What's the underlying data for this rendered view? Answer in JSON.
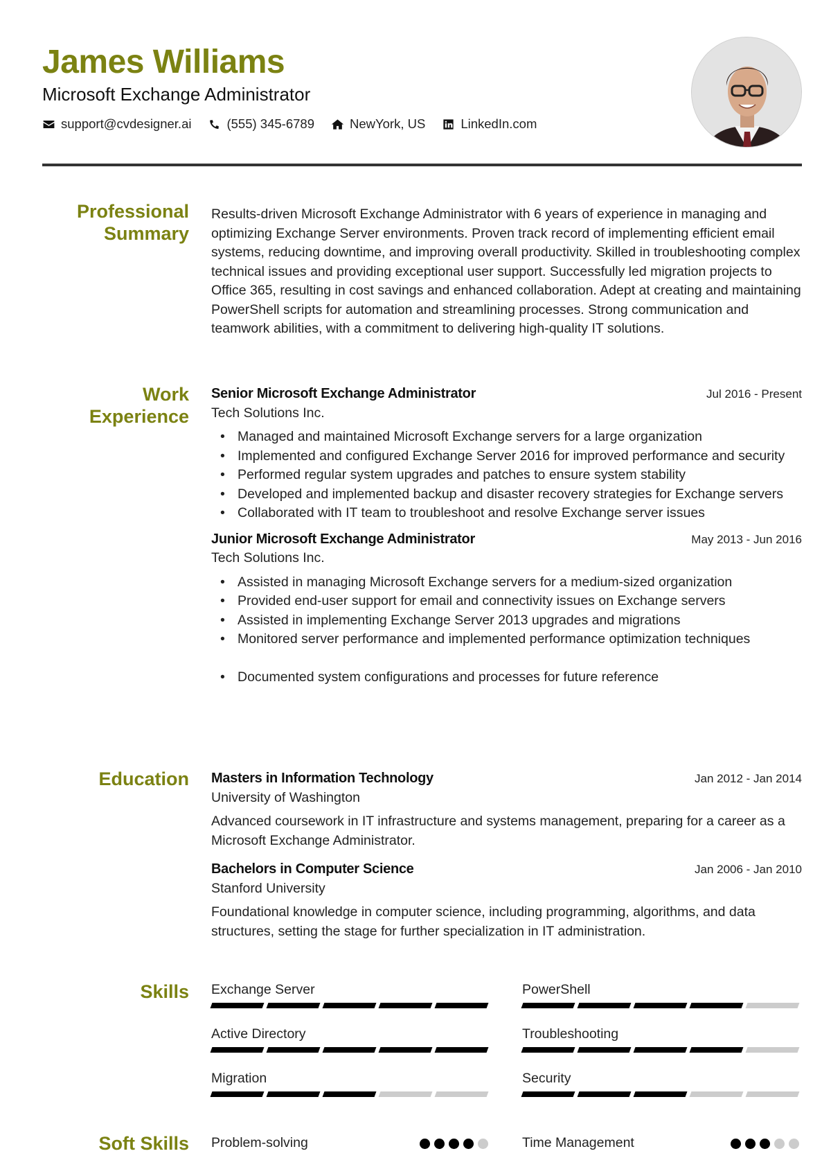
{
  "header": {
    "name": "James Williams",
    "title": "Microsoft Exchange Administrator",
    "contacts": [
      {
        "icon": "envelope-icon",
        "text": "support@cvdesigner.ai"
      },
      {
        "icon": "phone-icon",
        "text": "(555) 345-6789"
      },
      {
        "icon": "home-icon",
        "text": "NewYork, US"
      },
      {
        "icon": "linkedin-icon",
        "text": "LinkedIn.com"
      }
    ],
    "photo_alt": "Profile photo of James Williams"
  },
  "colors": {
    "accent": "#7b8212",
    "text": "#222222",
    "divider": "#333333",
    "bar_on": "#000000",
    "bar_off": "#cccccc"
  },
  "summary": {
    "label": "Professional Summary",
    "text": "Results-driven Microsoft Exchange Administrator with 6 years of experience in managing and optimizing Exchange Server environments. Proven track record of implementing efficient email systems, reducing downtime, and improving overall productivity. Skilled in troubleshooting complex technical issues and providing exceptional user support. Successfully led migration projects to Office 365, resulting in cost savings and enhanced collaboration. Adept at creating and maintaining PowerShell scripts for automation and streamlining processes. Strong communication and teamwork abilities, with a commitment to delivering high-quality IT solutions."
  },
  "experience": {
    "label": "Work Experience",
    "jobs": [
      {
        "title": "Senior Microsoft Exchange Administrator",
        "company": "Tech Solutions Inc.",
        "dates": "Jul 2016 - Present",
        "bullets": [
          "Managed and maintained Microsoft Exchange servers for a large organization",
          "Implemented and configured Exchange Server 2016 for improved performance and security",
          "Performed regular system upgrades and patches to ensure system stability",
          "Developed and implemented backup and disaster recovery strategies for Exchange servers",
          "Collaborated with IT team to troubleshoot and resolve Exchange server issues"
        ]
      },
      {
        "title": "Junior Microsoft Exchange Administrator",
        "company": "Tech Solutions Inc.",
        "dates": "May 2013 - Jun 2016",
        "bullets": [
          "Assisted in managing Microsoft Exchange servers for a medium-sized organization",
          "Provided end-user support for email and connectivity issues on Exchange servers",
          "Assisted in implementing Exchange Server 2013 upgrades and migrations",
          "Monitored server performance and implemented performance optimization techniques",
          "Documented system configurations and processes for future reference"
        ]
      }
    ]
  },
  "education": {
    "label": "Education",
    "items": [
      {
        "degree": "Masters in Information Technology",
        "school": "University of Washington",
        "dates": "Jan 2012 - Jan 2014",
        "description": "Advanced coursework in IT infrastructure and systems management, preparing for a career as a Microsoft Exchange Administrator."
      },
      {
        "degree": "Bachelors in Computer Science",
        "school": "Stanford University",
        "dates": "Jan 2006 - Jan 2010",
        "description": "Foundational knowledge in computer science, including programming, algorithms, and data structures, setting the stage for further specialization in IT administration."
      }
    ]
  },
  "skills": {
    "label": "Skills",
    "max_level": 5,
    "items": [
      {
        "name": "Exchange Server",
        "level": 5
      },
      {
        "name": "PowerShell",
        "level": 4
      },
      {
        "name": "Active Directory",
        "level": 5
      },
      {
        "name": "Troubleshooting",
        "level": 4
      },
      {
        "name": "Migration",
        "level": 3
      },
      {
        "name": "Security",
        "level": 3
      }
    ]
  },
  "soft_skills": {
    "label": "Soft Skills",
    "max_level": 5,
    "items": [
      {
        "name": "Problem-solving",
        "level": 4
      },
      {
        "name": "Time Management",
        "level": 3
      }
    ]
  }
}
